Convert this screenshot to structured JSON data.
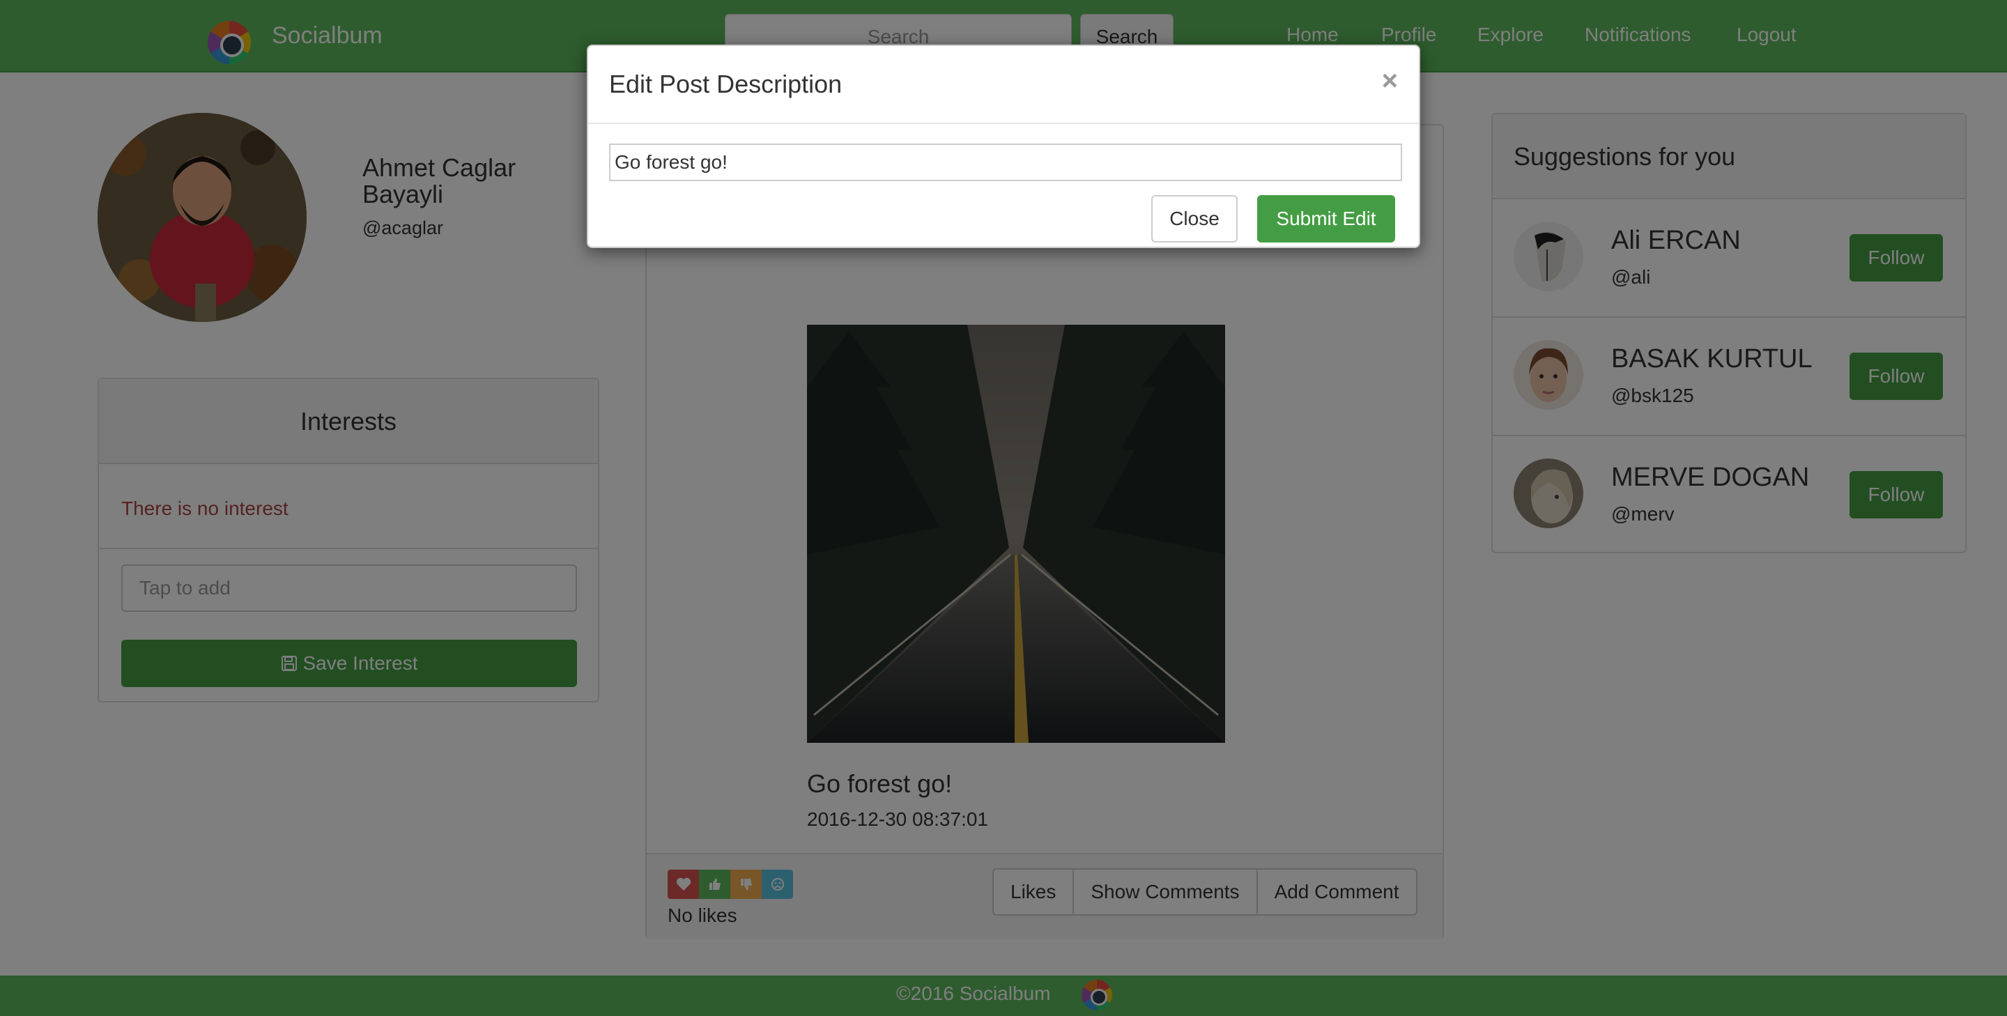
{
  "navbar": {
    "brand": "Socialbum",
    "search_placeholder": "Search",
    "search_button": "Search",
    "links": [
      "Home",
      "Profile",
      "Explore",
      "Notifications",
      "Logout"
    ]
  },
  "profile": {
    "name": "Ahmet Caglar Bayayli",
    "handle": "@acaglar"
  },
  "interests": {
    "title": "Interests",
    "empty_message": "There is no interest",
    "input_placeholder": "Tap to add",
    "save_button": "Save Interest"
  },
  "post": {
    "description": "Go forest go!",
    "date": "2016-12-30 08:37:01",
    "likes_text": "No likes",
    "buttons": [
      "Likes",
      "Show Comments",
      "Add Comment"
    ]
  },
  "suggestions": {
    "title": "Suggestions for you",
    "follow_label": "Follow",
    "users": [
      {
        "name": "Ali ERCAN",
        "handle": "@ali"
      },
      {
        "name": "BASAK KURTUL",
        "handle": "@bsk125"
      },
      {
        "name": "MERVE DOGAN",
        "handle": "@merv"
      }
    ]
  },
  "footer": {
    "text": "©2016 Socialbum"
  },
  "modal": {
    "title": "Edit Post Description",
    "close_symbol": "×",
    "input_value": "Go forest go!",
    "close_button": "Close",
    "submit_button": "Submit Edit"
  },
  "colors": {
    "brand_green": "#5cb85c",
    "button_green": "#449d44",
    "danger_text": "#a94442"
  }
}
